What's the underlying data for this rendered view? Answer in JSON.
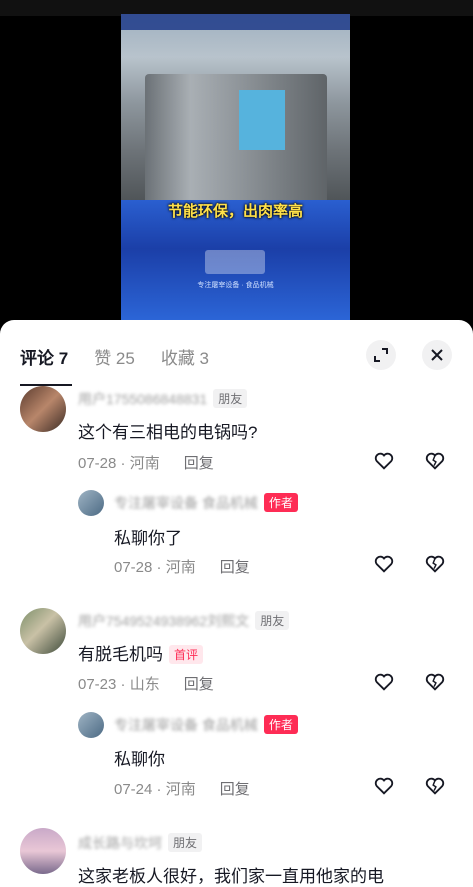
{
  "video": {
    "caption": "节能环保，出肉率高",
    "subtitle": "专注屠宰设备 · 食品机械"
  },
  "tabs": [
    {
      "label": "评论 7"
    },
    {
      "label": "赞 25"
    },
    {
      "label": "收藏 3"
    }
  ],
  "comments": [
    {
      "user": "用户1755086848831",
      "badge": "朋友",
      "text": "这个有三相电的电锅吗?",
      "date": "07-28",
      "location": "河南",
      "reply_label": "回复"
    },
    {
      "user": "专注屠宰设备 食品机械",
      "badge": "作者",
      "text": "私聊你了",
      "date": "07-28",
      "location": "河南",
      "reply_label": "回复"
    },
    {
      "user": "用户7549524938962刘熙文",
      "badge": "朋友",
      "text": "有脱毛机吗",
      "tag": "首评",
      "date": "07-23",
      "location": "山东",
      "reply_label": "回复"
    },
    {
      "user": "专注屠宰设备 食品机械",
      "badge": "作者",
      "text": "私聊你",
      "date": "07-24",
      "location": "河南",
      "reply_label": "回复"
    },
    {
      "user": "成长路与坎坷",
      "badge": "朋友",
      "text": "这家老板人很好，我们家一直用他家的电"
    }
  ],
  "colors": {
    "author_badge": "#fe2c55",
    "text": "#161823",
    "meta": "#8a8a8a"
  },
  "icons": [
    "expand-icon",
    "close-icon",
    "heart-icon",
    "dislike-icon"
  ]
}
